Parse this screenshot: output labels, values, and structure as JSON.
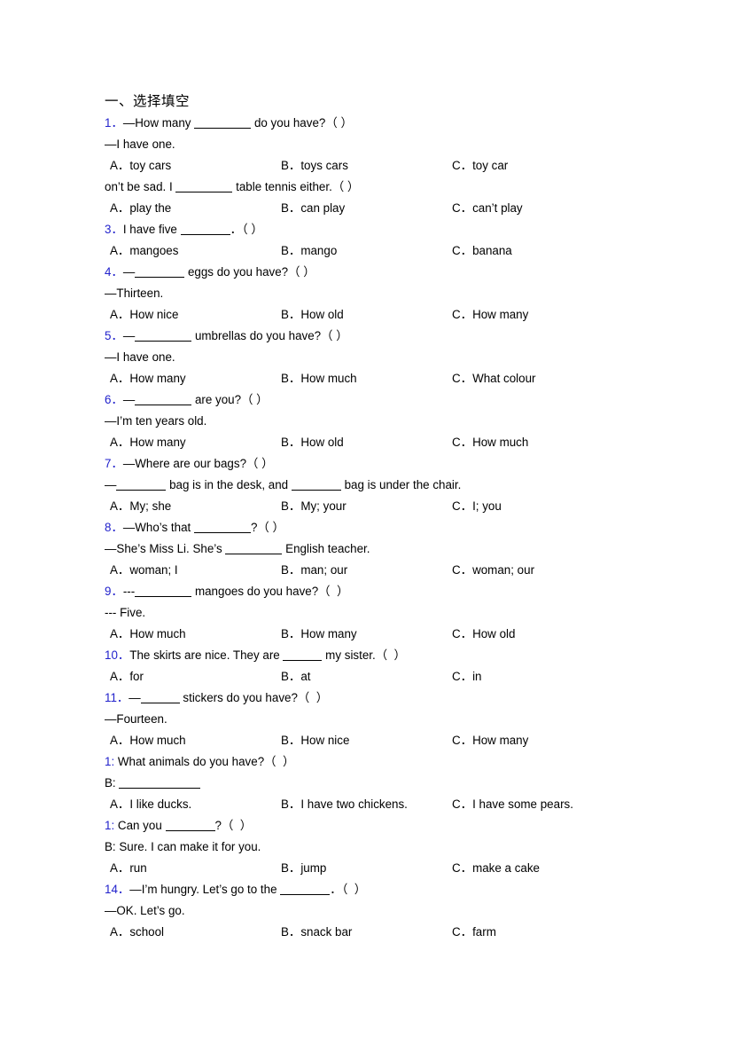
{
  "document": {
    "section_heading": "一、选择填空",
    "option_labels": {
      "a": "A．",
      "b": "B．",
      "c": "C．"
    }
  },
  "questions": [
    {
      "number": "1．",
      "stem_pre": "—How many ",
      "stem_post": " do you have?（ ）",
      "answer_line": "—I have one.",
      "a": "toy cars",
      "b": "toys cars",
      "c": "toy car"
    },
    {
      "number": "",
      "stem_pre": "on’t be sad. I ",
      "stem_post": " table tennis either.（ ）",
      "answer_line": "",
      "a": "play the",
      "b": "can play",
      "c": "can’t play"
    },
    {
      "number": "3．",
      "stem_pre": "I have five ",
      "stem_post": "．（ ）",
      "answer_line": "",
      "a": "mangoes",
      "b": "mango",
      "c": "banana"
    },
    {
      "number": "4．",
      "stem_pre": "—",
      "stem_post": " eggs do you have?（ ）",
      "answer_line": "—Thirteen.",
      "a": "How nice",
      "b": "How old",
      "c": "How many"
    },
    {
      "number": "5．",
      "stem_pre": "—",
      "stem_post": " umbrellas do you have?（ ）",
      "answer_line": "—I have one.",
      "a": "How many",
      "b": "How much",
      "c": "What colour"
    },
    {
      "number": "6．",
      "stem_pre": "—",
      "stem_post": " are you?（ ）",
      "answer_line": "—I’m ten years old.",
      "a": "How many",
      "b": "How old",
      "c": "How much"
    },
    {
      "number": "7．",
      "stem_pre": "—Where are our bags?（ ）",
      "stem_post": "",
      "answer_line": "—______ bag is in the desk, and ______ bag is under the chair.",
      "a": "My; she",
      "b": "My; your",
      "c": "I; you"
    },
    {
      "number": "8．",
      "stem_pre": "—Who’s that ",
      "stem_post": "?（ ）",
      "answer_line": "—She’s Miss Li. She’s ________ English teacher.",
      "a": "woman; I",
      "b": "man; our",
      "c": "woman; our"
    },
    {
      "number": "9．",
      "stem_pre": "---",
      "stem_post": " mangoes do you have?（  ）",
      "answer_line": "--- Five.",
      "a": "How much",
      "b": "How many",
      "c": "How old"
    },
    {
      "number": "10．",
      "stem_pre": "The skirts are nice. They are ",
      "stem_post": " my sister.（  ）",
      "answer_line": "",
      "a": "for",
      "b": "at",
      "c": "in"
    },
    {
      "number": "11．",
      "stem_pre": "—",
      "stem_post": " stickers do you have?（  ）",
      "answer_line": "—Fourteen.",
      "a": "How much",
      "b": "How nice",
      "c": "How many"
    },
    {
      "number": "1:",
      "stem_pre": " What animals do you have?（  ）",
      "stem_post": "",
      "answer_line": "B: ____________",
      "a": "I like ducks.",
      "b": "I have two chickens.",
      "c": "I have some pears."
    },
    {
      "number": "1:",
      "stem_pre": " Can you ",
      "stem_post": "?（  ）",
      "answer_line": "B: Sure. I can make it for you.",
      "a": "run",
      "b": "jump",
      "c": "make a cake"
    },
    {
      "number": "14．",
      "stem_pre": "—I’m hungry. Let’s go to the ",
      "stem_post": "．（  ）",
      "answer_line": "—OK. Let’s go.",
      "a": "school",
      "b": "snack bar",
      "c": "farm"
    }
  ],
  "colors": {
    "question_number": "#2222cc",
    "text": "#000000",
    "background": "#ffffff"
  }
}
